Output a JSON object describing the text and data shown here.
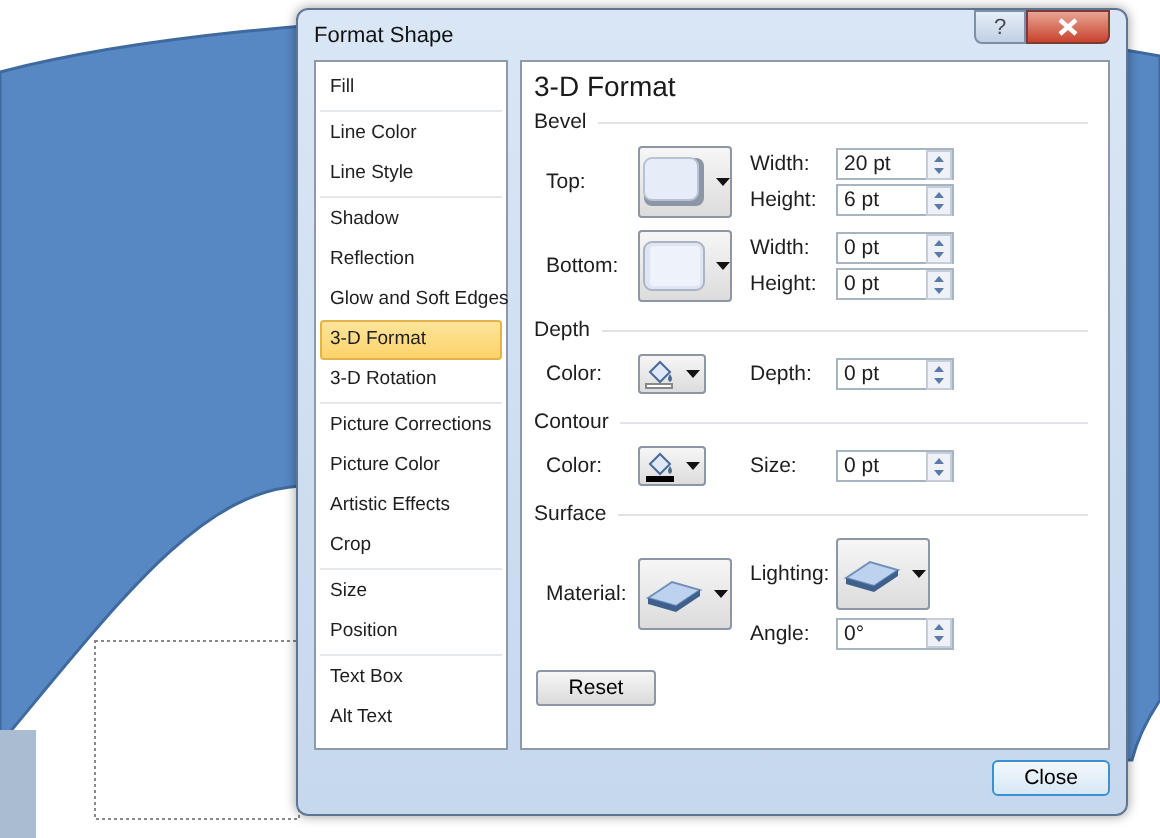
{
  "window": {
    "title": "Format Shape",
    "help": "?"
  },
  "nav": [
    {
      "items": [
        {
          "label": "Fill",
          "selected": false
        }
      ]
    },
    {
      "items": [
        {
          "label": "Line Color",
          "selected": false
        },
        {
          "label": "Line Style",
          "selected": false
        }
      ]
    },
    {
      "items": [
        {
          "label": "Shadow",
          "selected": false
        },
        {
          "label": "Reflection",
          "selected": false
        },
        {
          "label": "Glow and Soft Edges",
          "selected": false
        },
        {
          "label": "3-D Format",
          "selected": true
        },
        {
          "label": "3-D Rotation",
          "selected": false
        }
      ]
    },
    {
      "items": [
        {
          "label": "Picture Corrections",
          "selected": false
        },
        {
          "label": "Picture Color",
          "selected": false
        },
        {
          "label": "Artistic Effects",
          "selected": false
        },
        {
          "label": "Crop",
          "selected": false
        }
      ]
    },
    {
      "items": [
        {
          "label": "Size",
          "selected": false
        },
        {
          "label": "Position",
          "selected": false
        }
      ]
    },
    {
      "items": [
        {
          "label": "Text Box",
          "selected": false
        },
        {
          "label": "Alt Text",
          "selected": false
        }
      ]
    }
  ],
  "panel": {
    "title": "3-D Format",
    "sections": [
      {
        "heading": "Bevel",
        "rows": [
          {
            "label": "Top:",
            "picker": {
              "kind": "bevel"
            },
            "right": [
              {
                "kind": "spin",
                "label": "Width:",
                "value": "20 pt"
              },
              {
                "kind": "spin",
                "label": "Height:",
                "value": "6 pt"
              }
            ]
          },
          {
            "label": "Bottom:",
            "picker": {
              "kind": "flat"
            },
            "right": [
              {
                "kind": "spin",
                "label": "Width:",
                "value": "0 pt"
              },
              {
                "kind": "spin",
                "label": "Height:",
                "value": "0 pt"
              }
            ]
          }
        ]
      },
      {
        "heading": "Depth",
        "rows": [
          {
            "label": "Color:",
            "picker": {
              "kind": "fill"
            },
            "right": [
              {
                "kind": "spin",
                "label": "Depth:",
                "value": "0 pt"
              }
            ]
          }
        ]
      },
      {
        "heading": "Contour",
        "rows": [
          {
            "label": "Color:",
            "picker": {
              "kind": "outline"
            },
            "right": [
              {
                "kind": "spin",
                "label": "Size:",
                "value": "0 pt"
              }
            ]
          }
        ]
      },
      {
        "heading": "Surface",
        "rows": [
          {
            "label": "Material:",
            "picker": {
              "kind": "material"
            },
            "right": [
              {
                "kind": "picker",
                "label": "Lighting:",
                "picker": {
                  "kind": "lighting"
                }
              },
              {
                "kind": "spin",
                "label": "Angle:",
                "value": "0°"
              }
            ]
          }
        ]
      }
    ],
    "reset": "Reset"
  },
  "close": "Close"
}
